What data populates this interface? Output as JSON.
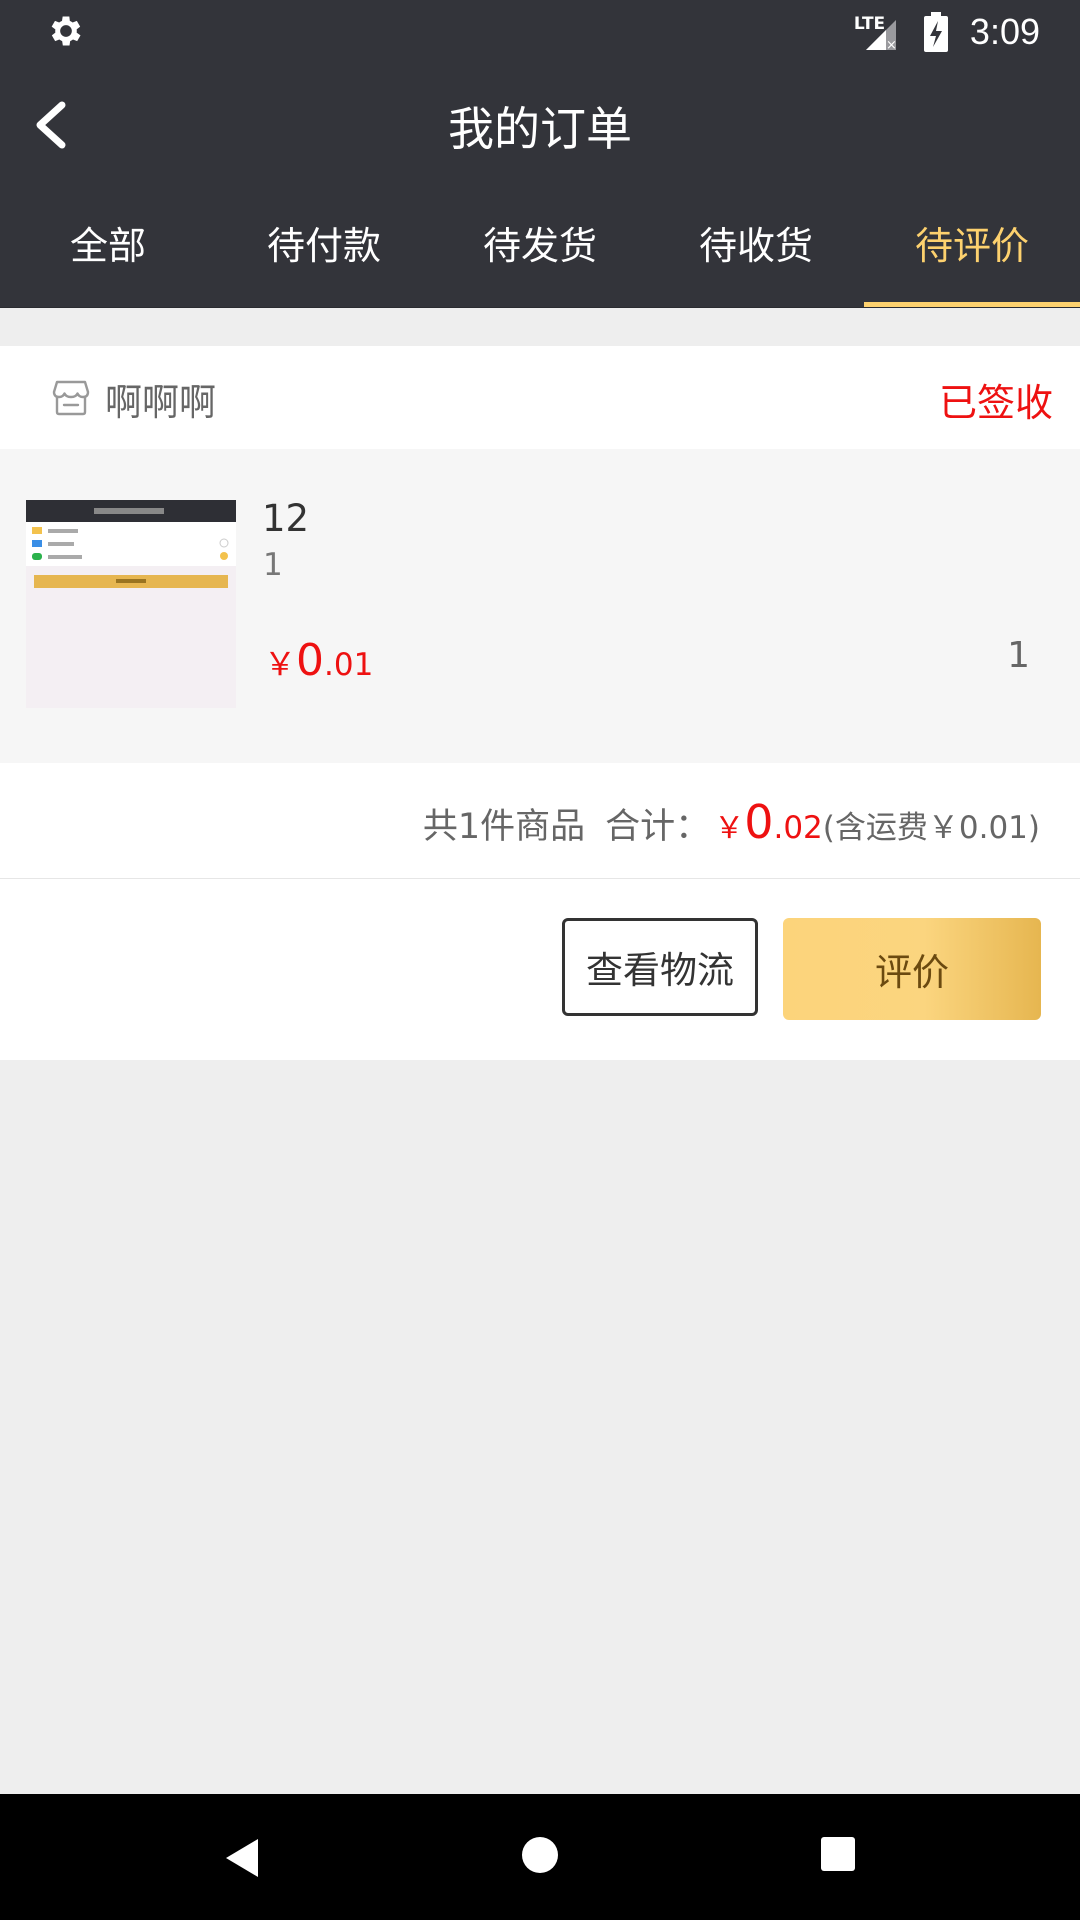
{
  "status_bar": {
    "network": "LTE",
    "time": "3:09"
  },
  "header": {
    "title": "我的订单"
  },
  "tabs": [
    {
      "label": "全部",
      "active": false
    },
    {
      "label": "待付款",
      "active": false
    },
    {
      "label": "待发货",
      "active": false
    },
    {
      "label": "待收货",
      "active": false
    },
    {
      "label": "待评价",
      "active": true
    }
  ],
  "order": {
    "shop_name": "啊啊啊",
    "status": "已签收",
    "product": {
      "name": "12",
      "spec": "1",
      "price_currency": "￥",
      "price_int": "0",
      "price_dec": ".01",
      "quantity": "1"
    },
    "summary": {
      "count_text": "共1件商品",
      "total_label": "合计：",
      "currency": "￥",
      "total_int": "0",
      "total_dec": ".02",
      "shipping_text": "(含运费￥0.01)"
    },
    "buttons": {
      "logistics": "查看物流",
      "review": "评价"
    }
  },
  "colors": {
    "header_bg": "#33343a",
    "accent": "#fdd16e",
    "price_red": "#ee1111"
  }
}
